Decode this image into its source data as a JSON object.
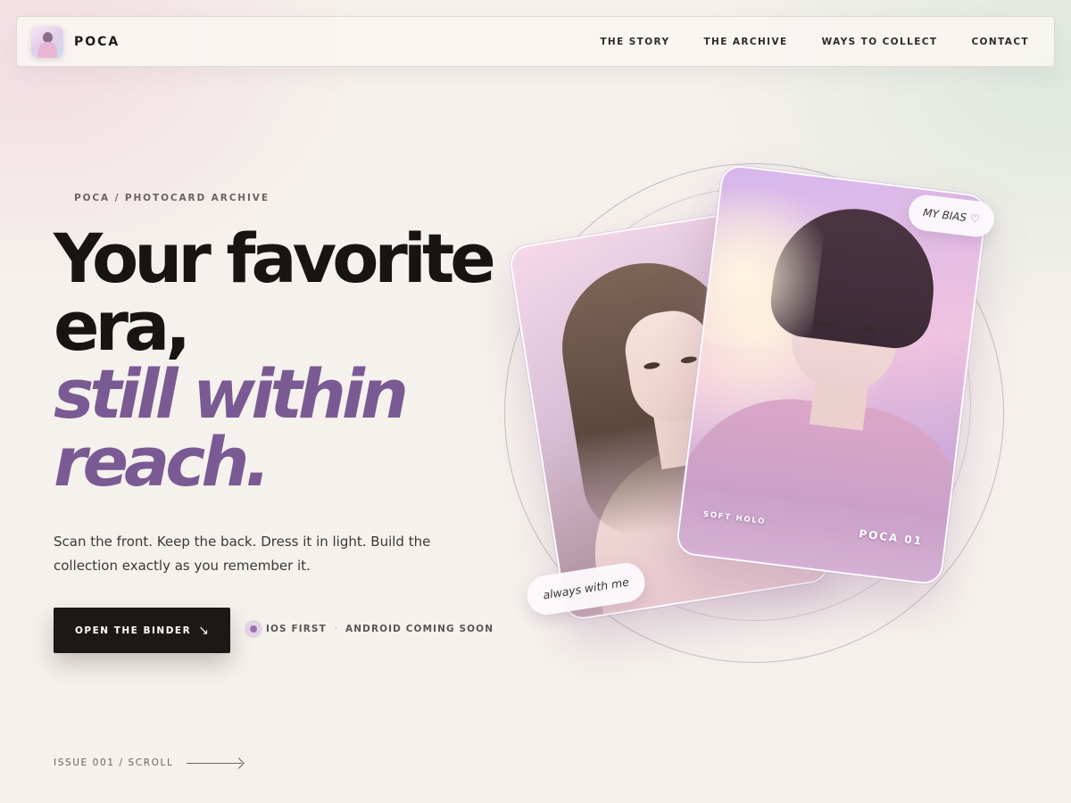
{
  "nav": {
    "brand": "POCA",
    "links": [
      "THE STORY",
      "THE ARCHIVE",
      "WAYS TO COLLECT",
      "CONTACT"
    ]
  },
  "hero": {
    "eyebrow": "POCA / PHOTOCARD ARCHIVE",
    "headline": [
      "Your favorite",
      "era,"
    ],
    "headline_accent": [
      "still within",
      "reach."
    ],
    "lede": "Scan the front. Keep the back. Dress it in light. Build the collection exactly as you remember it.",
    "cta_label": "OPEN THE BINDER",
    "cta_icon": "arrow-down-right-icon",
    "platform_primary": "IOS FIRST",
    "platform_separator": "·",
    "platform_secondary": "ANDROID COMING SOON",
    "issue": "ISSUE 001 / SCROLL"
  },
  "cards": {
    "bias_pill": "MY BIAS",
    "bias_icon": "heart-icon",
    "front_tag": "SOFT HOLO",
    "front_number": "POCA 01",
    "back_caption": "always with me"
  },
  "colors": {
    "accent": "#7a5a93",
    "ink": "#171412",
    "background": "#f5f1ec",
    "cta": "#1b1816"
  }
}
